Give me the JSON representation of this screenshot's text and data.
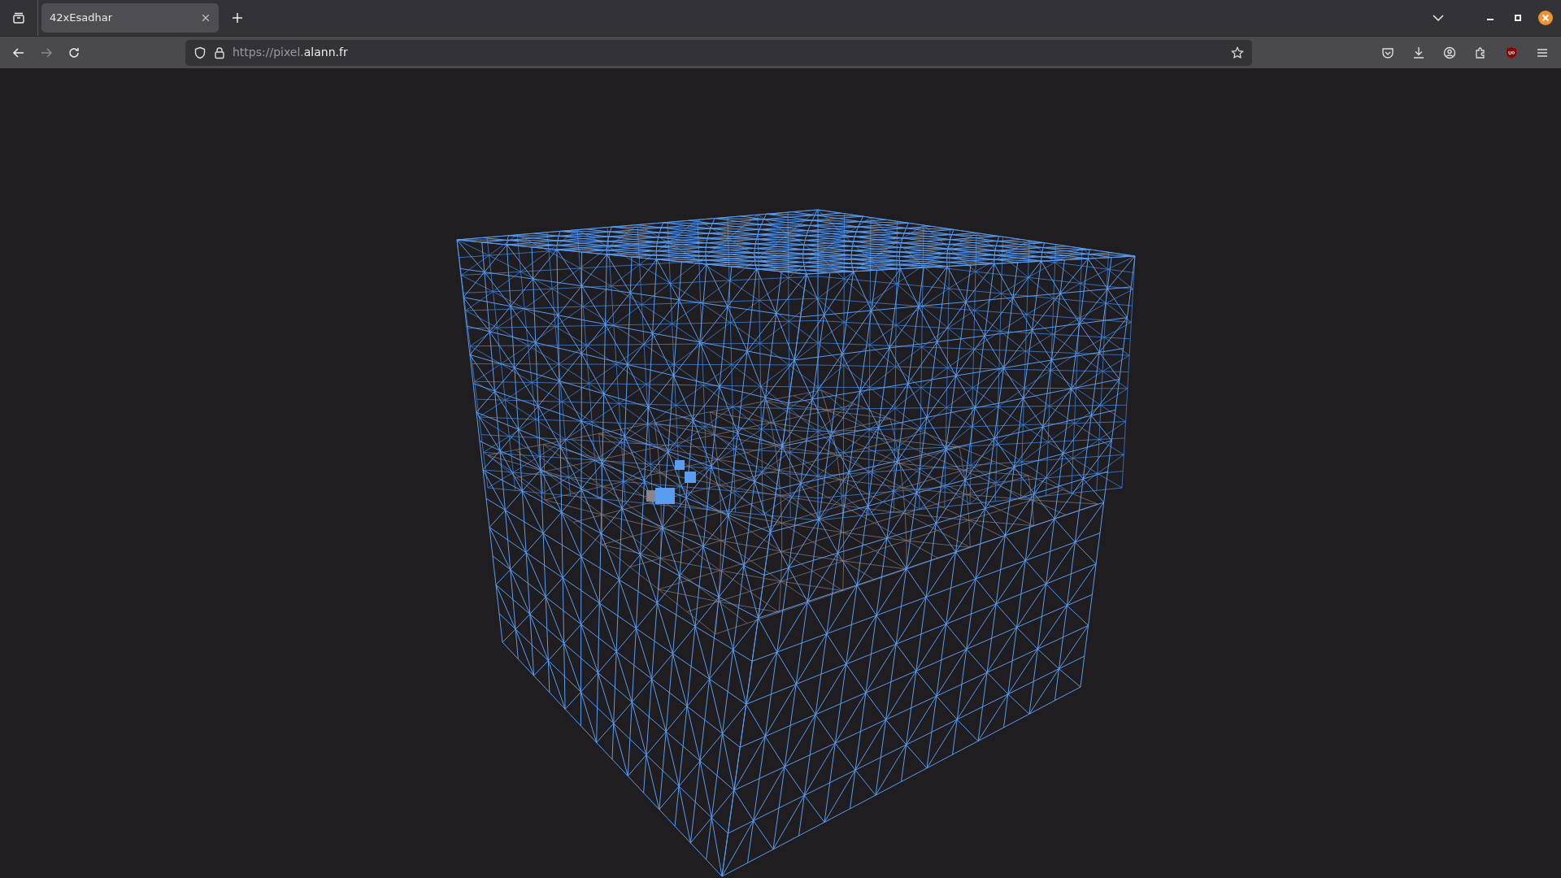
{
  "tabs": [
    {
      "title": "42xEsadhar",
      "selected": true
    }
  ],
  "nav": [
    {
      "kind": "back",
      "disabled": false
    },
    {
      "kind": "forward",
      "disabled": true
    },
    {
      "kind": "reload",
      "disabled": false
    }
  ],
  "address": {
    "scheme_and_subdomain": "https://pixel.",
    "domain": "alann.fr"
  }
}
